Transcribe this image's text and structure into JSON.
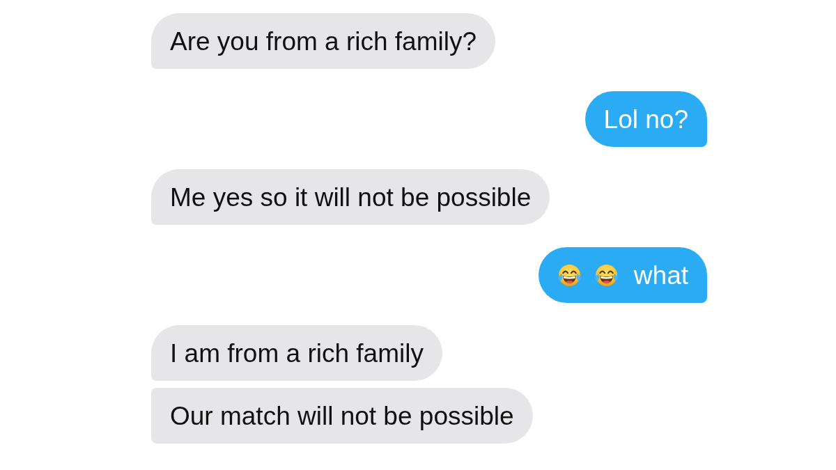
{
  "messages": [
    {
      "kind": "received",
      "text": "Are you from a rich family?"
    },
    {
      "kind": "sent",
      "text": "Lol no?"
    },
    {
      "kind": "received",
      "text": "Me yes so it will not be possible"
    },
    {
      "kind": "sent",
      "icons": [
        {
          "kind": "emoji"
        },
        {
          "kind": "emoji"
        }
      ],
      "text": "what"
    },
    {
      "kind": "received",
      "text": "I am from a rich family"
    },
    {
      "kind": "received",
      "text": "Our match will not be possible"
    }
  ]
}
